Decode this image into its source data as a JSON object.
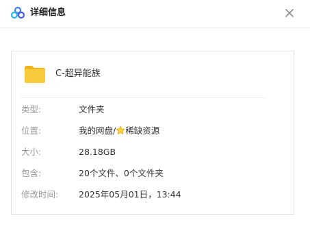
{
  "header": {
    "title": "详细信息",
    "logo_icon": "cloud-drive-logo-icon",
    "close_icon": "close-icon"
  },
  "file": {
    "icon": "folder-icon",
    "name": "C-超异能族"
  },
  "details": {
    "type": {
      "label": "类型:",
      "value": "文件夹"
    },
    "location": {
      "label": "位置:",
      "value_prefix": "我的网盘/",
      "star_icon": "star-icon",
      "value_suffix": "稀缺资源"
    },
    "size": {
      "label": "大小:",
      "value": "28.18GB"
    },
    "contents": {
      "label": "包含:",
      "value": "20个文件、0个文件夹"
    },
    "modified": {
      "label": "修改时间:",
      "value": "2025年05月01日，13:44"
    }
  },
  "colors": {
    "folder": "#F8C52D",
    "label": "#9A9A9A",
    "text": "#333333",
    "border": "#E3E3E3"
  }
}
